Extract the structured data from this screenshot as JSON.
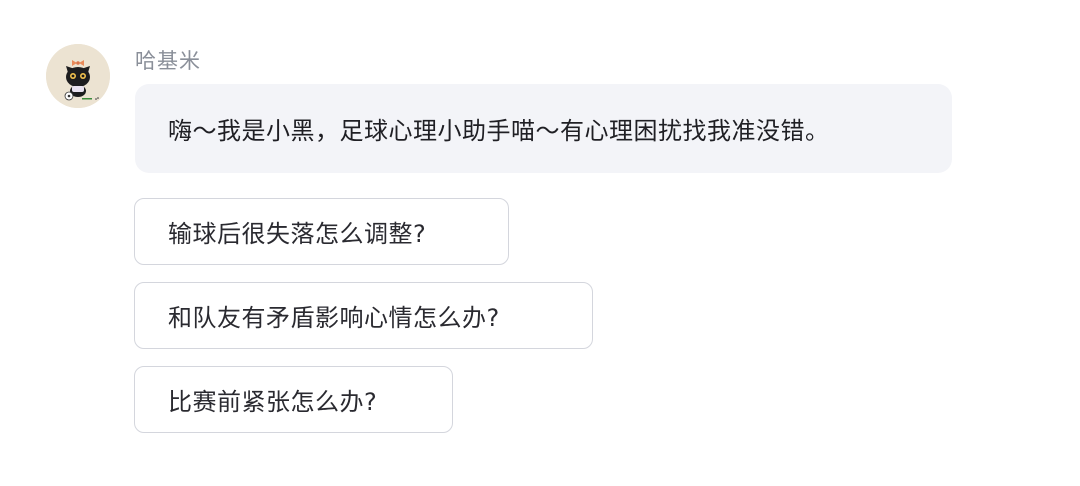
{
  "message": {
    "sender_name": "哈基米",
    "avatar_icon": "black-cat-avatar-icon",
    "text": "嗨～我是小黑，足球心理小助手喵～有心理困扰找我准没错。"
  },
  "suggestions": [
    "输球后很失落怎么调整?",
    "和队友有矛盾影响心情怎么办?",
    "比赛前紧张怎么办?"
  ],
  "colors": {
    "bubble_background": "#f3f4f8",
    "name_text": "#8a8f99",
    "suggestion_border": "#d4d6dd"
  }
}
